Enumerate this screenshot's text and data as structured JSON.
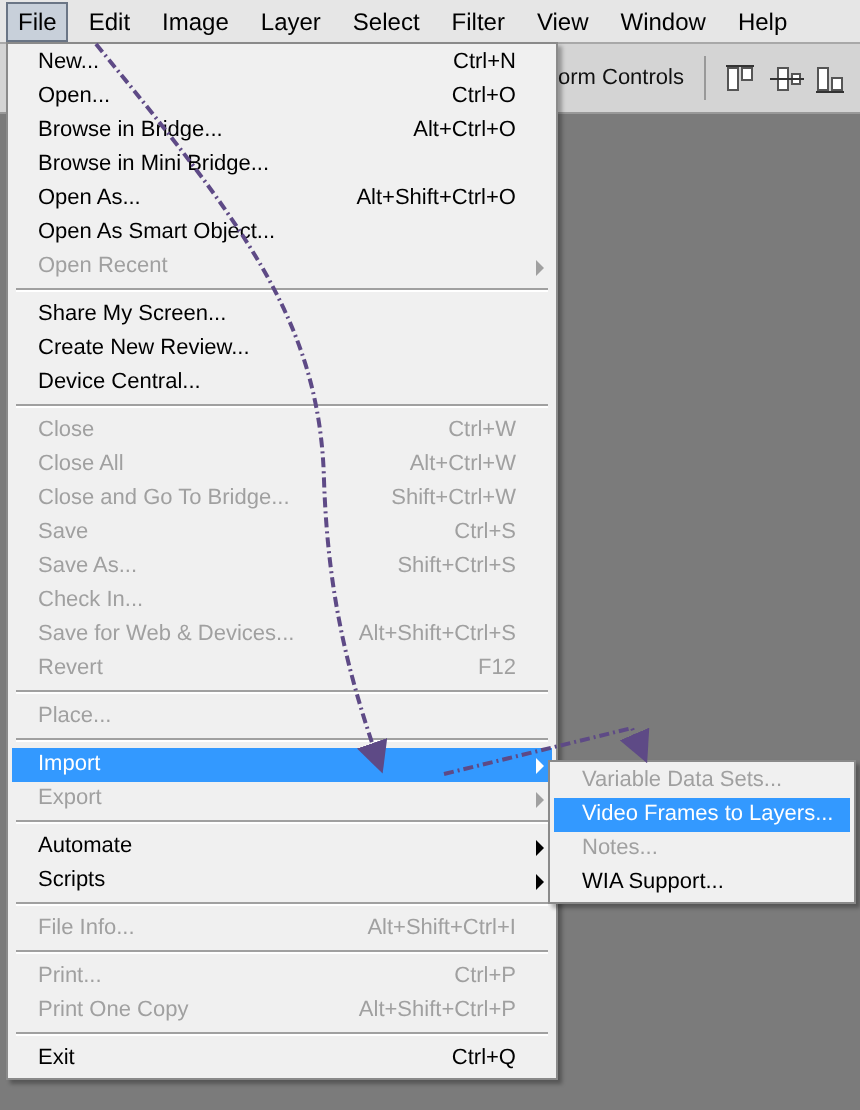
{
  "menubar": [
    {
      "label": "File",
      "selected": true
    },
    {
      "label": "Edit",
      "selected": false
    },
    {
      "label": "Image",
      "selected": false
    },
    {
      "label": "Layer",
      "selected": false
    },
    {
      "label": "Select",
      "selected": false
    },
    {
      "label": "Filter",
      "selected": false
    },
    {
      "label": "View",
      "selected": false
    },
    {
      "label": "Window",
      "selected": false
    },
    {
      "label": "Help",
      "selected": false
    }
  ],
  "toolbar": {
    "label": "orm Controls"
  },
  "menu": [
    {
      "kind": "item",
      "label": "New...",
      "shortcut": "Ctrl+N",
      "disabled": false,
      "submenu": false,
      "selected": false
    },
    {
      "kind": "item",
      "label": "Open...",
      "shortcut": "Ctrl+O",
      "disabled": false,
      "submenu": false,
      "selected": false
    },
    {
      "kind": "item",
      "label": "Browse in Bridge...",
      "shortcut": "Alt+Ctrl+O",
      "disabled": false,
      "submenu": false,
      "selected": false
    },
    {
      "kind": "item",
      "label": "Browse in Mini Bridge...",
      "disabled": false,
      "submenu": false,
      "selected": false
    },
    {
      "kind": "item",
      "label": "Open As...",
      "shortcut": "Alt+Shift+Ctrl+O",
      "disabled": false,
      "submenu": false,
      "selected": false
    },
    {
      "kind": "item",
      "label": "Open As Smart Object...",
      "disabled": false,
      "submenu": false,
      "selected": false
    },
    {
      "kind": "item",
      "label": "Open Recent",
      "disabled": true,
      "submenu": true,
      "selected": false
    },
    {
      "kind": "separator"
    },
    {
      "kind": "item",
      "label": "Share My Screen...",
      "disabled": false,
      "submenu": false,
      "selected": false
    },
    {
      "kind": "item",
      "label": "Create New Review...",
      "disabled": false,
      "submenu": false,
      "selected": false
    },
    {
      "kind": "item",
      "label": "Device Central...",
      "disabled": false,
      "submenu": false,
      "selected": false
    },
    {
      "kind": "separator"
    },
    {
      "kind": "item",
      "label": "Close",
      "shortcut": "Ctrl+W",
      "disabled": true,
      "submenu": false,
      "selected": false
    },
    {
      "kind": "item",
      "label": "Close All",
      "shortcut": "Alt+Ctrl+W",
      "disabled": true,
      "submenu": false,
      "selected": false
    },
    {
      "kind": "item",
      "label": "Close and Go To Bridge...",
      "shortcut": "Shift+Ctrl+W",
      "disabled": true,
      "submenu": false,
      "selected": false
    },
    {
      "kind": "item",
      "label": "Save",
      "shortcut": "Ctrl+S",
      "disabled": true,
      "submenu": false,
      "selected": false
    },
    {
      "kind": "item",
      "label": "Save As...",
      "shortcut": "Shift+Ctrl+S",
      "disabled": true,
      "submenu": false,
      "selected": false
    },
    {
      "kind": "item",
      "label": "Check In...",
      "disabled": true,
      "submenu": false,
      "selected": false
    },
    {
      "kind": "item",
      "label": "Save for Web & Devices...",
      "shortcut": "Alt+Shift+Ctrl+S",
      "disabled": true,
      "submenu": false,
      "selected": false
    },
    {
      "kind": "item",
      "label": "Revert",
      "shortcut": "F12",
      "disabled": true,
      "submenu": false,
      "selected": false
    },
    {
      "kind": "separator"
    },
    {
      "kind": "item",
      "label": "Place...",
      "disabled": true,
      "submenu": false,
      "selected": false
    },
    {
      "kind": "separator"
    },
    {
      "kind": "item",
      "label": "Import",
      "disabled": false,
      "submenu": true,
      "selected": true
    },
    {
      "kind": "item",
      "label": "Export",
      "disabled": true,
      "submenu": true,
      "selected": false
    },
    {
      "kind": "separator"
    },
    {
      "kind": "item",
      "label": "Automate",
      "disabled": false,
      "submenu": true,
      "selected": false
    },
    {
      "kind": "item",
      "label": "Scripts",
      "disabled": false,
      "submenu": true,
      "selected": false
    },
    {
      "kind": "separator"
    },
    {
      "kind": "item",
      "label": "File Info...",
      "shortcut": "Alt+Shift+Ctrl+I",
      "disabled": true,
      "submenu": false,
      "selected": false
    },
    {
      "kind": "separator"
    },
    {
      "kind": "item",
      "label": "Print...",
      "shortcut": "Ctrl+P",
      "disabled": true,
      "submenu": false,
      "selected": false
    },
    {
      "kind": "item",
      "label": "Print One Copy",
      "shortcut": "Alt+Shift+Ctrl+P",
      "disabled": true,
      "submenu": false,
      "selected": false
    },
    {
      "kind": "separator"
    },
    {
      "kind": "item",
      "label": "Exit",
      "shortcut": "Ctrl+Q",
      "disabled": false,
      "submenu": false,
      "selected": false
    }
  ],
  "submenu": [
    {
      "label": "Variable Data Sets...",
      "disabled": true,
      "selected": false
    },
    {
      "label": "Video Frames to Layers...",
      "disabled": false,
      "selected": true
    },
    {
      "label": "Notes...",
      "disabled": true,
      "selected": false
    },
    {
      "label": "WIA Support...",
      "disabled": false,
      "selected": false
    }
  ]
}
